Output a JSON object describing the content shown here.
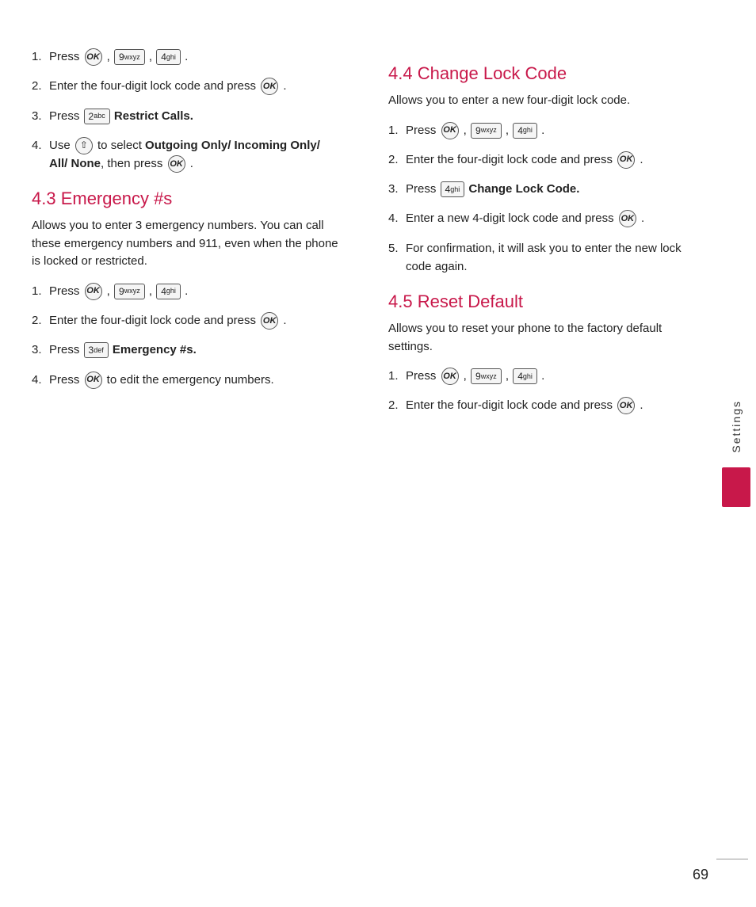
{
  "left": {
    "steps_top": [
      {
        "num": "1.",
        "type": "press_keys",
        "text_before": "Press",
        "keys": [
          "OK",
          "9wxyz",
          "4ghi"
        ],
        "text_after": "."
      },
      {
        "num": "2.",
        "type": "text",
        "content": "Enter the four-digit lock code and press"
      },
      {
        "num": "3.",
        "type": "press_key_bold",
        "text_before": "Press",
        "key": "2abc",
        "bold": "Restrict Calls."
      },
      {
        "num": "4.",
        "type": "text_rich",
        "content": "Use  to select Outgoing Only/ Incoming Only/ All/ None, then press  ."
      }
    ],
    "section_43": {
      "heading": "4.3 Emergency #s",
      "intro": "Allows you to enter 3 emergency numbers. You can call these emergency numbers and 911, even when the phone is locked or restricted.",
      "steps": [
        {
          "num": "1.",
          "type": "press_keys",
          "text_before": "Press",
          "keys": [
            "OK",
            "9wxyz",
            "4ghi"
          ],
          "text_after": "."
        },
        {
          "num": "2.",
          "type": "text_ok",
          "content": "Enter the four-digit lock code and press"
        },
        {
          "num": "3.",
          "type": "press_key_bold",
          "text_before": "Press",
          "key": "3def",
          "bold": "Emergency #s."
        },
        {
          "num": "4.",
          "type": "text_ok",
          "content": "Press  to edit the emergency numbers."
        }
      ]
    }
  },
  "right": {
    "section_44": {
      "heading": "4.4 Change Lock Code",
      "intro": "Allows you to enter a new four-digit lock code.",
      "steps": [
        {
          "num": "1.",
          "type": "press_keys",
          "text_before": "Press",
          "keys": [
            "OK",
            "9wxyz",
            "4ghi"
          ],
          "text_after": "."
        },
        {
          "num": "2.",
          "type": "text_ok",
          "content": "Enter the four-digit lock code and press"
        },
        {
          "num": "3.",
          "type": "press_key_bold",
          "text_before": "Press",
          "key": "4ghi",
          "bold": "Change Lock Code."
        },
        {
          "num": "4.",
          "type": "text_ok",
          "content": "Enter a new 4-digit lock code and press"
        },
        {
          "num": "5.",
          "type": "text",
          "content": "For confirmation, it will ask you to enter the new lock code again."
        }
      ]
    },
    "section_45": {
      "heading": "4.5 Reset Default",
      "intro": "Allows you to reset your phone to the factory default settings.",
      "steps": [
        {
          "num": "1.",
          "type": "press_keys",
          "text_before": "Press",
          "keys": [
            "OK",
            "9wxyz",
            "4ghi"
          ],
          "text_after": "."
        },
        {
          "num": "2.",
          "type": "text_ok",
          "content": "Enter the four-digit lock code and press"
        }
      ]
    }
  },
  "sidebar": {
    "label": "Settings"
  },
  "page_number": "69"
}
